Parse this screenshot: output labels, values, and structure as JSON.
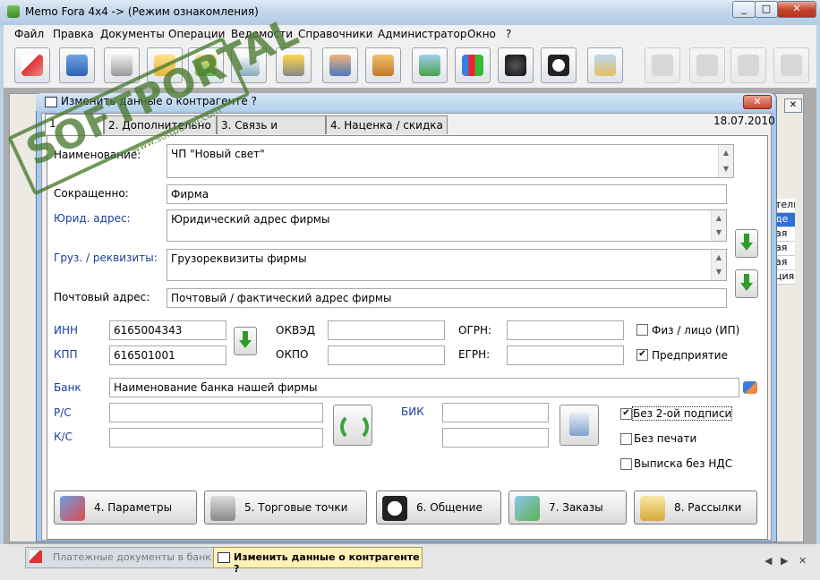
{
  "window": {
    "title": "Memo Fora 4x4 -> (Режим ознакомления)",
    "min": "_",
    "max": "□",
    "close": "✕"
  },
  "menu": [
    "Файл",
    "Правка",
    "Документы",
    "Операции",
    "Ведомости",
    "Справочники",
    "Администратор",
    "Окно",
    "?"
  ],
  "toolbar_icons": [
    "edit-icon",
    "card-icon",
    "cash-register-icon",
    "add-folder-icon",
    "folder-down-icon",
    "print-icon",
    "forklift-icon",
    "users-icon",
    "box-icon",
    "contact-card-icon",
    "chart-icon",
    "binoculars-icon",
    "headset-icon",
    "message-icon",
    "tool-1-icon",
    "tool-2-icon",
    "tool-3-icon",
    "tool-4-icon"
  ],
  "watermark": {
    "text": "SOFTPORTAL",
    "url": "www.softportal.com"
  },
  "dialog": {
    "title": "Изменить данные о контрагенте ?",
    "close": "✕",
    "date": "18.07.2010",
    "tabs": [
      "1. Общие",
      "2. Дополнительно",
      "3. Связь и группы",
      "4. Наценка / скидка"
    ],
    "fields": {
      "name_label": "Наименование:",
      "name_value": "ЧП \"Новый свет\"",
      "short_label": "Сокращенно:",
      "short_value": "Фирма",
      "legal_label": "Юрид. адрес:",
      "legal_value": "Юридический адрес фирмы",
      "cargo_label": "Груз. / реквизиты:",
      "cargo_value": "Грузореквизиты фирмы",
      "post_label": "Почтовый адрес:",
      "post_value": "Почтовый / фактический адрес фирмы",
      "inn_label": "ИНН",
      "inn_value": "6165004343",
      "kpp_label": "КПП",
      "kpp_value": "616501001",
      "okved_label": "ОКВЭД",
      "okpo_label": "ОКПО",
      "ogrn_label": "ОГРН:",
      "egrn_label": "ЕГРН:",
      "bank_label": "Банк",
      "bank_value": "Наименование банка нашей фирмы",
      "rs_label": "Р/С",
      "ks_label": "К/С",
      "bik_label": "БИК"
    },
    "checkboxes": [
      {
        "label": "Физ / лицо (ИП)",
        "checked": false
      },
      {
        "label": "Предприятие",
        "checked": true
      },
      {
        "label": "Без 2-ой подписи",
        "checked": true
      },
      {
        "label": "Без печати",
        "checked": false
      },
      {
        "label": "Выписка без НДС",
        "checked": false
      }
    ],
    "buttons": [
      "4. Параметры",
      "5. Торговые точки",
      "6. Общение",
      "7. Заказы",
      "8. Рассылки"
    ]
  },
  "background_cells": [
    "тель",
    "де",
    "ая т",
    "ая т",
    "ая т",
    "ция"
  ],
  "taskbar": {
    "tab1": "Платежные документы в банк",
    "tab2": "Изменить данные о контрагенте ?"
  }
}
